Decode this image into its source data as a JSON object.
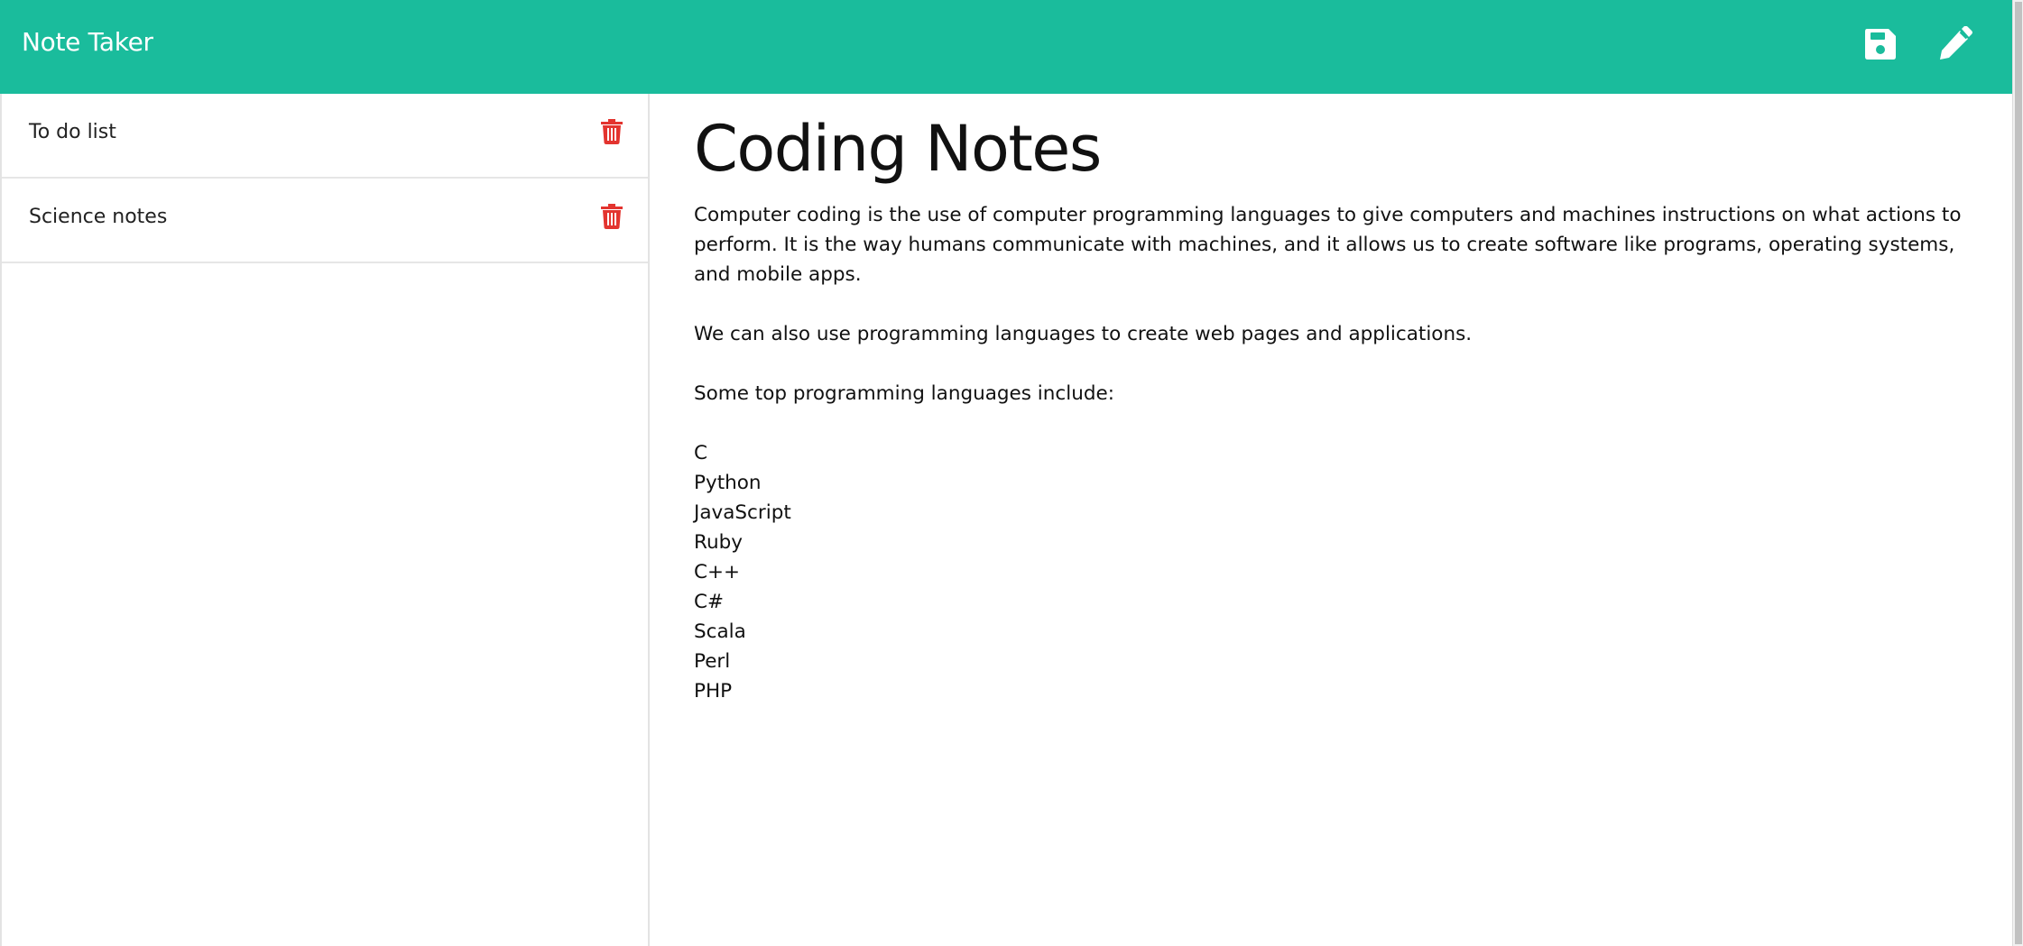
{
  "navbar": {
    "brand": "Note Taker",
    "background": "#1abc9c",
    "save_icon": "floppy-disk-icon",
    "write_icon": "pencil-icon"
  },
  "sidebar": {
    "items": [
      {
        "label": "To do list",
        "delete_icon": "trash-icon"
      },
      {
        "label": "Science notes",
        "delete_icon": "trash-icon"
      }
    ],
    "delete_color": "#e3342f"
  },
  "note": {
    "title": "Coding Notes",
    "paragraph_1": "Computer coding is the use of computer programming languages to give computers and machines instructions on what actions to perform. It is the way humans communicate with machines, and it allows us to create software like programs, operating systems, and mobile apps.",
    "paragraph_2": "We can also use programming languages to create web pages and applications.",
    "paragraph_3": "Some top programming languages include:",
    "languages": [
      "C",
      "Python",
      "JavaScript",
      "Ruby",
      "C++",
      "C#",
      "Scala",
      "Perl",
      "PHP"
    ]
  }
}
